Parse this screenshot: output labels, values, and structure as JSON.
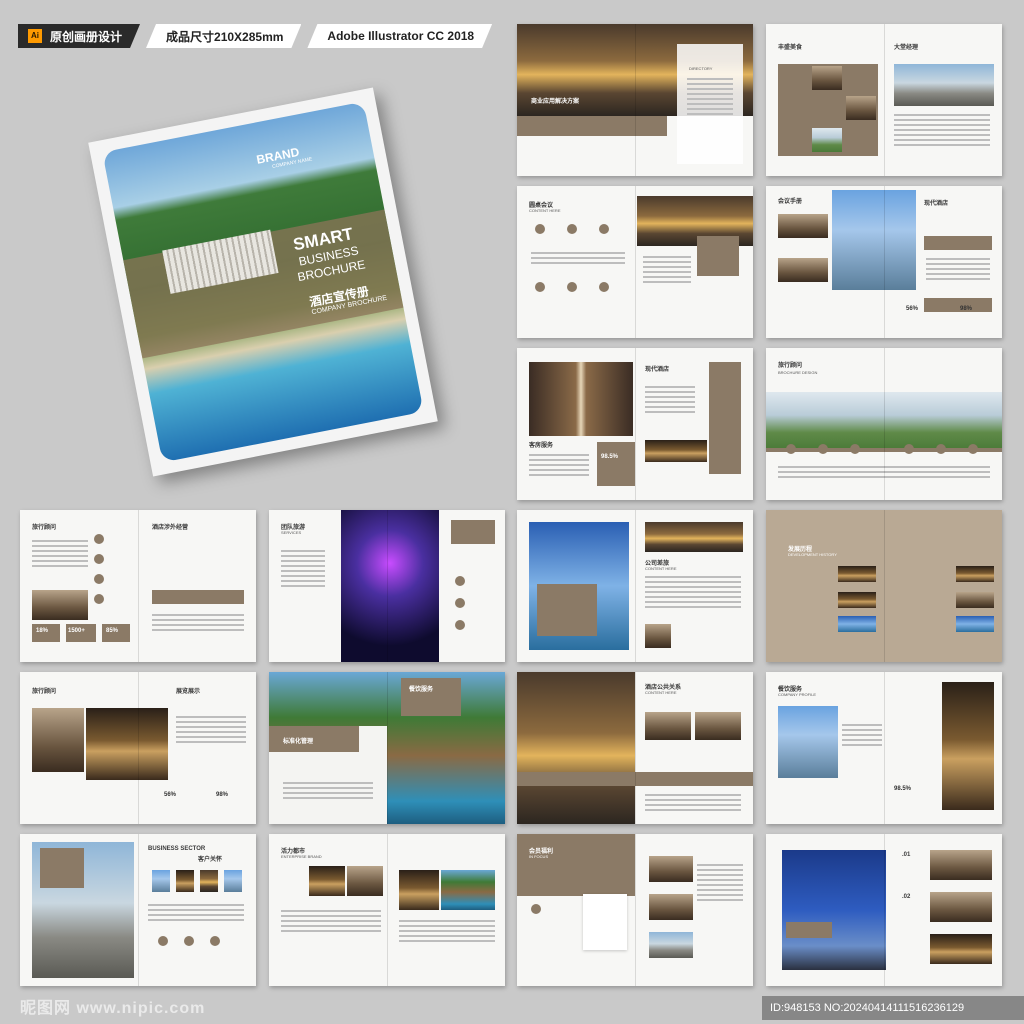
{
  "header": {
    "tag1": "原创画册设计",
    "tag2": "成品尺寸210X285mm",
    "tag3": "Adobe Illustrator CC 2018",
    "ai_badge": "Ai"
  },
  "cover": {
    "brand": "BRAND",
    "brand_sub": "COMPANY NAME",
    "title1": "SMART",
    "title2": "BUSINESS",
    "title3": "BROCHURE",
    "cn_title": "酒店宣传册",
    "en_title": "COMPANY BROCHURE"
  },
  "spreads": [
    {
      "title": "商业应用解决方案",
      "sub": "DIRECTORY"
    },
    {
      "title": "丰盛美食",
      "sub": "大堂经理"
    },
    {
      "title": "圆桌会议",
      "sub": "CONTENT HERE"
    },
    {
      "title": "会议手册",
      "sub": "现代酒店"
    },
    {
      "title": "现代酒店",
      "sub": "客房服务"
    },
    {
      "title": "旅行顾问",
      "sub": "BROCHURE DESIGN"
    },
    {
      "title": "旅行顾问",
      "sub": "酒店涉外经营"
    },
    {
      "title": "团队旅游",
      "sub": "SERVICES"
    },
    {
      "title": "公司差旅",
      "sub": "CONTENT HERE"
    },
    {
      "title": "发展历程",
      "sub": "DEVELOPMENT HISTORY"
    },
    {
      "title": "旅行顾问",
      "sub": "展览展示"
    },
    {
      "title": "标准化管理",
      "sub": "餐饮服务"
    },
    {
      "title": "酒店公共关系",
      "sub": "CONTENT HERE"
    },
    {
      "title": "餐饮服务",
      "sub": "COMPANY PROFILE"
    },
    {
      "title": "BUSINESS SECTOR",
      "sub": "客户关怀"
    },
    {
      "title": "活力都市",
      "sub": "ENTERPRISE BRAND"
    },
    {
      "title": "会员福利",
      "sub": "IN FOCUS"
    },
    {
      "title": ".01",
      "sub": ".02"
    }
  ],
  "stats": {
    "a": "98.5%",
    "b": "56%",
    "c": "98%",
    "d": "18%",
    "e": "1500+",
    "f": "85%"
  },
  "footer": {
    "left": "昵图网 www.nipic.com",
    "right": "ID:948153 NO:20240414111516236129"
  }
}
